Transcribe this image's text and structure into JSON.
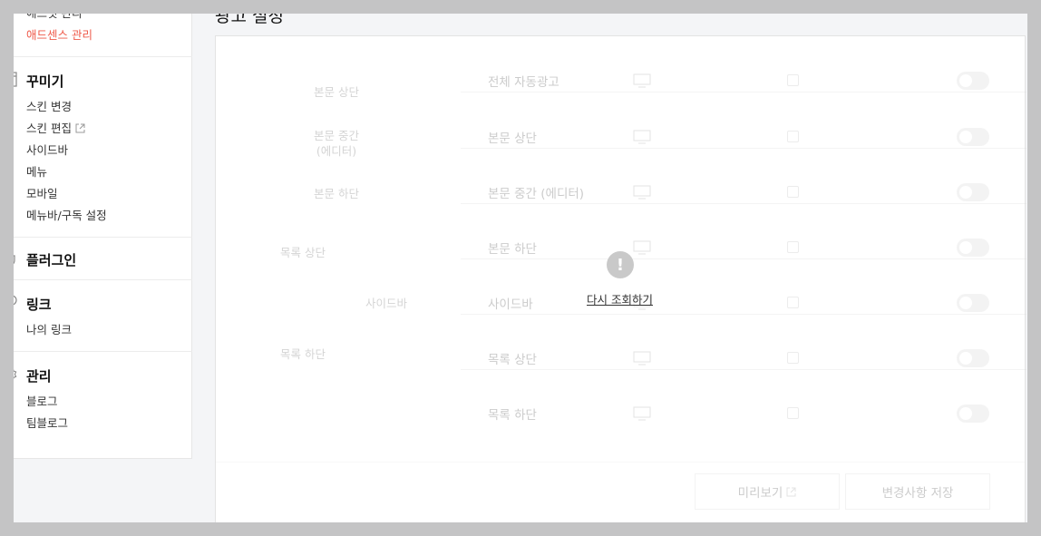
{
  "sidebar": {
    "top_items": [
      "애드핏 관리",
      "애드센스 관리"
    ],
    "decorate": {
      "heading": "꾸미기",
      "items": [
        "스킨 변경",
        "스킨 편집",
        "사이드바",
        "메뉴",
        "모바일",
        "메뉴바/구독 설정"
      ]
    },
    "plugin": {
      "heading": "플러그인"
    },
    "link": {
      "heading": "링크",
      "items": [
        "나의 링크"
      ]
    },
    "manage": {
      "heading": "관리",
      "items": [
        "블로그",
        "팀블로그"
      ]
    }
  },
  "page": {
    "title": "광고 설정"
  },
  "layout_preview": {
    "labels": [
      "본문 상단",
      "본문 중간\n(에디터)",
      "본문 하단",
      "목록 상단",
      "사이드바",
      "목록 하단"
    ]
  },
  "ad_rows": [
    {
      "label": "전체 자동광고"
    },
    {
      "label": "본문 상단"
    },
    {
      "label": "본문 중간 (에디터)"
    },
    {
      "label": "본문 하단"
    },
    {
      "label": "사이드바"
    },
    {
      "label": "목록 상단"
    },
    {
      "label": "목록 하단"
    }
  ],
  "error": {
    "icon": "exclamation-icon",
    "retry_label": "다시 조회하기"
  },
  "footer": {
    "preview_label": "미리보기",
    "save_label": "변경사항 저장"
  },
  "colors": {
    "active": "#ef5a4a",
    "backdrop": "#c4c4c5"
  }
}
